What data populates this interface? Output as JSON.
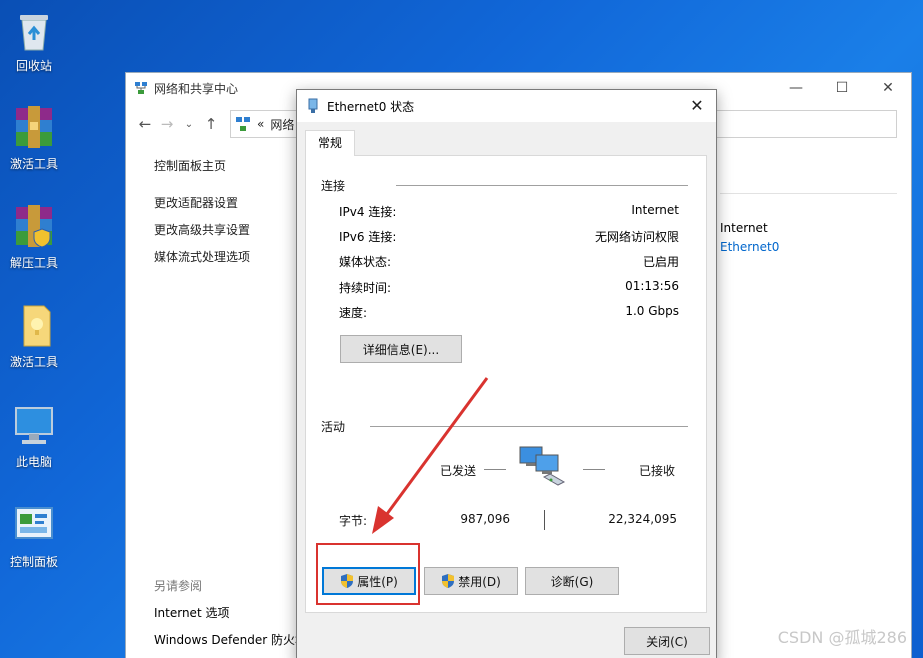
{
  "desktop": {
    "icons": [
      {
        "label": "回收站",
        "icon": "recycle-bin-icon"
      },
      {
        "label": "激活工具",
        "icon": "winrar-icon"
      },
      {
        "label": "解压工具",
        "icon": "winrar-shield-icon"
      },
      {
        "label": "激活工具",
        "icon": "folder-icon"
      },
      {
        "label": "此电脑",
        "icon": "computer-icon"
      },
      {
        "label": "控制面板",
        "icon": "control-panel-icon"
      }
    ]
  },
  "bg_window": {
    "title": "网络和共享中心",
    "address": "网络",
    "address_prefix": "«",
    "left_nav": [
      "控制面板主页",
      "更改适配器设置",
      "更改高级共享设置",
      "媒体流式处理选项"
    ],
    "see_also_header": "另请参阅",
    "see_also": [
      "Internet 选项",
      "Windows Defender 防火墙"
    ],
    "access_type": "Internet",
    "connection_link": "Ethernet0"
  },
  "dialog": {
    "title": "Ethernet0 状态",
    "tab": "常规",
    "connection_group": "连接",
    "rows": [
      {
        "label": "IPv4 连接:",
        "value": "Internet"
      },
      {
        "label": "IPv6 连接:",
        "value": "无网络访问权限"
      },
      {
        "label": "媒体状态:",
        "value": "已启用"
      },
      {
        "label": "持续时间:",
        "value": "01:13:56"
      },
      {
        "label": "速度:",
        "value": "1.0 Gbps"
      }
    ],
    "details_button": "详细信息(E)...",
    "activity_group": "活动",
    "sent_label": "已发送",
    "received_label": "已接收",
    "bytes_label": "字节:",
    "bytes_sent": "987,096",
    "bytes_received": "22,324,095",
    "properties_button": "属性(P)",
    "disable_button": "禁用(D)",
    "diagnose_button": "诊断(G)",
    "close_button": "关闭(C)"
  },
  "watermark": "CSDN @孤城286",
  "colors": {
    "accent": "#0078d7",
    "annotation_red": "#d9332f",
    "link": "#0066cc"
  }
}
